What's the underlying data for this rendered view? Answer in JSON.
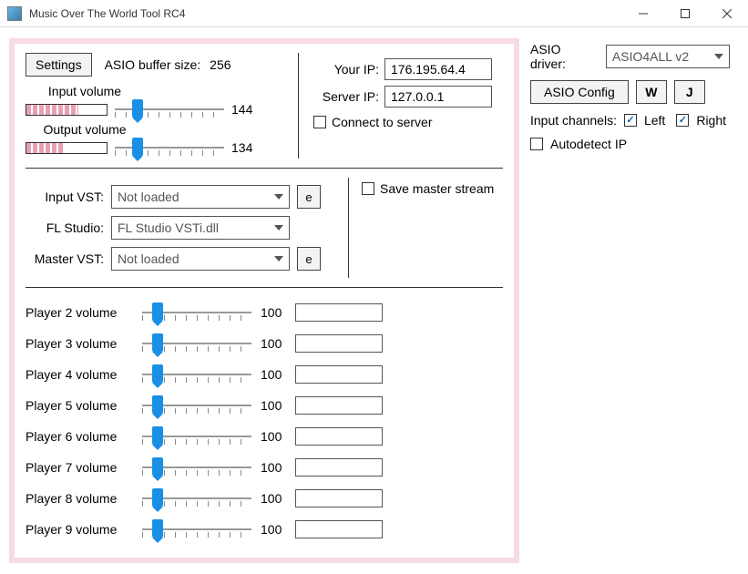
{
  "window": {
    "title": "Music Over The World Tool RC4"
  },
  "topbar": {
    "settings_label": "Settings",
    "asio_buffer_label": "ASIO buffer size:",
    "asio_buffer_value": "256"
  },
  "volumes": {
    "input_label": "Input volume",
    "input_value": "144",
    "input_slider_pct": 18,
    "input_vu_pct": 65,
    "output_label": "Output volume",
    "output_value": "134",
    "output_slider_pct": 18,
    "output_vu_pct": 48
  },
  "network": {
    "your_ip_label": "Your IP:",
    "your_ip_value": "176.195.64.4",
    "server_ip_label": "Server IP:",
    "server_ip_value": "127.0.0.1",
    "connect_label": "Connect to server",
    "connect_checked": false
  },
  "vst": {
    "input_vst_label": "Input VST:",
    "input_vst_value": "Not loaded",
    "fl_label": "FL Studio:",
    "fl_value": "FL Studio VSTi.dll",
    "master_vst_label": "Master VST:",
    "master_vst_value": "Not loaded",
    "e_btn": "e",
    "save_master_label": "Save master stream",
    "save_master_checked": false
  },
  "players": [
    {
      "label": "Player 2 volume",
      "value": "100",
      "slider_pct": 10
    },
    {
      "label": "Player 3 volume",
      "value": "100",
      "slider_pct": 10
    },
    {
      "label": "Player 4 volume",
      "value": "100",
      "slider_pct": 10
    },
    {
      "label": "Player 5 volume",
      "value": "100",
      "slider_pct": 10
    },
    {
      "label": "Player 6 volume",
      "value": "100",
      "slider_pct": 10
    },
    {
      "label": "Player 7 volume",
      "value": "100",
      "slider_pct": 10
    },
    {
      "label": "Player 8 volume",
      "value": "100",
      "slider_pct": 10
    },
    {
      "label": "Player 9 volume",
      "value": "100",
      "slider_pct": 10
    }
  ],
  "right": {
    "asio_driver_label": "ASIO driver:",
    "asio_driver_value": "ASIO4ALL v2",
    "asio_config_label": "ASIO Config",
    "w_label": "W",
    "j_label": "J",
    "input_channels_label": "Input channels:",
    "left_label": "Left",
    "left_checked": true,
    "right_label": "Right",
    "right_checked": true,
    "autodetect_label": "Autodetect IP",
    "autodetect_checked": false
  }
}
